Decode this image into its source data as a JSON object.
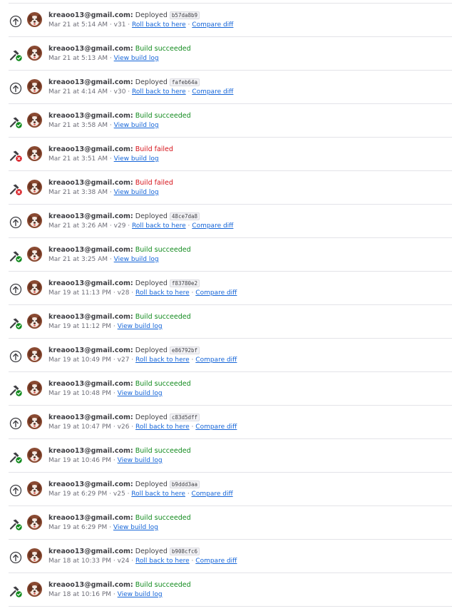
{
  "colors": {
    "success": "#118a1d",
    "failure": "#d6131a",
    "link": "#1565d8",
    "divider": "#e3e3e8"
  },
  "activities": [
    {
      "type": "deploy",
      "user": "kreaoo13@gmail.com:",
      "status": "Deployed",
      "hash": "b57da8b9",
      "time": "Mar 21 at 5:14 AM",
      "version": "v31",
      "link1": "Roll back to here",
      "link2": "Compare diff"
    },
    {
      "type": "build-success",
      "user": "kreaoo13@gmail.com:",
      "status": "Build succeeded",
      "time": "Mar 21 at 5:13 AM",
      "link1": "View build log"
    },
    {
      "type": "deploy",
      "user": "kreaoo13@gmail.com:",
      "status": "Deployed",
      "hash": "fafeb64a",
      "time": "Mar 21 at 4:14 AM",
      "version": "v30",
      "link1": "Roll back to here",
      "link2": "Compare diff"
    },
    {
      "type": "build-success",
      "user": "kreaoo13@gmail.com:",
      "status": "Build succeeded",
      "time": "Mar 21 at 3:58 AM",
      "link1": "View build log"
    },
    {
      "type": "build-failed",
      "user": "kreaoo13@gmail.com:",
      "status": "Build failed",
      "time": "Mar 21 at 3:51 AM",
      "link1": "View build log"
    },
    {
      "type": "build-failed",
      "user": "kreaoo13@gmail.com:",
      "status": "Build failed",
      "time": "Mar 21 at 3:38 AM",
      "link1": "View build log"
    },
    {
      "type": "deploy",
      "user": "kreaoo13@gmail.com:",
      "status": "Deployed",
      "hash": "48ce7da8",
      "time": "Mar 21 at 3:26 AM",
      "version": "v29",
      "link1": "Roll back to here",
      "link2": "Compare diff"
    },
    {
      "type": "build-success",
      "user": "kreaoo13@gmail.com:",
      "status": "Build succeeded",
      "time": "Mar 21 at 3:25 AM",
      "link1": "View build log"
    },
    {
      "type": "deploy",
      "user": "kreaoo13@gmail.com:",
      "status": "Deployed",
      "hash": "f83780e2",
      "time": "Mar 19 at 11:13 PM",
      "version": "v28",
      "link1": "Roll back to here",
      "link2": "Compare diff"
    },
    {
      "type": "build-success",
      "user": "kreaoo13@gmail.com:",
      "status": "Build succeeded",
      "time": "Mar 19 at 11:12 PM",
      "link1": "View build log"
    },
    {
      "type": "deploy",
      "user": "kreaoo13@gmail.com:",
      "status": "Deployed",
      "hash": "e86792bf",
      "time": "Mar 19 at 10:49 PM",
      "version": "v27",
      "link1": "Roll back to here",
      "link2": "Compare diff"
    },
    {
      "type": "build-success",
      "user": "kreaoo13@gmail.com:",
      "status": "Build succeeded",
      "time": "Mar 19 at 10:48 PM",
      "link1": "View build log"
    },
    {
      "type": "deploy",
      "user": "kreaoo13@gmail.com:",
      "status": "Deployed",
      "hash": "c83d5dff",
      "time": "Mar 19 at 10:47 PM",
      "version": "v26",
      "link1": "Roll back to here",
      "link2": "Compare diff"
    },
    {
      "type": "build-success",
      "user": "kreaoo13@gmail.com:",
      "status": "Build succeeded",
      "time": "Mar 19 at 10:46 PM",
      "link1": "View build log"
    },
    {
      "type": "deploy",
      "user": "kreaoo13@gmail.com:",
      "status": "Deployed",
      "hash": "b9ddd3aa",
      "time": "Mar 19 at 6:29 PM",
      "version": "v25",
      "link1": "Roll back to here",
      "link2": "Compare diff"
    },
    {
      "type": "build-success",
      "user": "kreaoo13@gmail.com:",
      "status": "Build succeeded",
      "time": "Mar 19 at 6:29 PM",
      "link1": "View build log"
    },
    {
      "type": "deploy",
      "user": "kreaoo13@gmail.com:",
      "status": "Deployed",
      "hash": "b908cfc6",
      "time": "Mar 18 at 10:33 PM",
      "version": "v24",
      "link1": "Roll back to here",
      "link2": "Compare diff"
    },
    {
      "type": "build-success",
      "user": "kreaoo13@gmail.com:",
      "status": "Build succeeded",
      "time": "Mar 18 at 10:16 PM",
      "link1": "View build log"
    }
  ]
}
